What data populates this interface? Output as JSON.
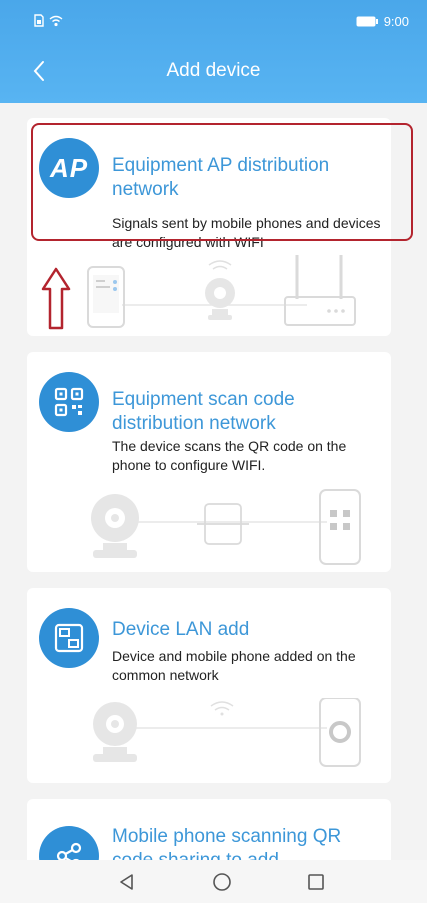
{
  "status_bar": {
    "time": "9:00"
  },
  "header": {
    "title": "Add device"
  },
  "cards": [
    {
      "icon_text": "AP",
      "title": "Equipment AP distribution network",
      "desc": "Signals sent by mobile phones and devices are configured with WIFI"
    },
    {
      "icon_text": "",
      "title": "Equipment scan code distribution network",
      "desc": "The device scans the QR code on the phone to configure WIFI."
    },
    {
      "icon_text": "",
      "title": "Device LAN add",
      "desc": "Device and mobile phone added on the common network"
    },
    {
      "icon_text": "",
      "title": "Mobile phone scanning QR code sharing to add",
      "desc": ""
    }
  ],
  "colors": {
    "header": "#4aa7ea",
    "accent": "#3d97d8",
    "icon_bg": "#2f8fd6",
    "highlight": "#b3242e"
  },
  "icons": [
    "back-icon",
    "qr-code-icon",
    "lan-icon",
    "share-icon",
    "camera-icon",
    "router-icon",
    "phone-icon",
    "wifi-icon",
    "up-arrow-icon"
  ]
}
